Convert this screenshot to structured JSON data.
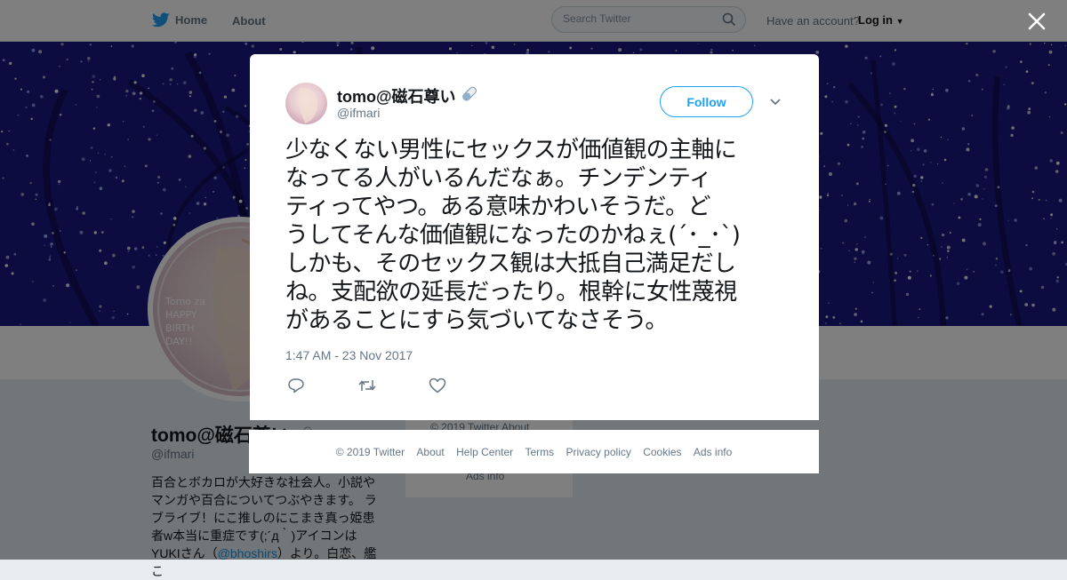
{
  "topnav": {
    "home_label": "Home",
    "about_label": "About",
    "search_placeholder": "Search Twitter",
    "account_prompt": "Have an account?",
    "login_label": "Log in"
  },
  "profile": {
    "name": "tomo@磁石尊い",
    "handle": "@ifmari",
    "avatar_text": "Tomo za HAPPY BIRTH DAY!!",
    "bio_before_link": "百合とボカロが大好きな社会人。小説やマンガや百合についてつぶやきます。 ラブライブ！にこ推しのにこまき真っ姫患者w本当に重症です(;´д｀)アイコンはYUKIさん（",
    "bio_link": "@bhoshirs",
    "bio_after_link": "）より。白恋、艦こ"
  },
  "side_card": {
    "line1": "© 2019 Twitter   About",
    "line2": "Ads info"
  },
  "tweet": {
    "author_name": "tomo@磁石尊い",
    "author_handle": "@ifmari",
    "follow_label": "Follow",
    "lines": [
      "少なくない男性にセックスが価値観の主軸に",
      "なってる人がいるんだなぁ。チンデンティ",
      "ティってやつ。ある意味かわいそうだ。ど",
      "うしてそんな価値観になったのかねぇ(´･_･`)",
      "しかも、そのセックス観は大抵自己満足だし",
      "ね。支配欲の延長だったり。根幹に女性蔑視",
      "があることにすら気づいてなさそう。"
    ],
    "timestamp": "1:47 AM - 23 Nov 2017"
  },
  "footer": {
    "links": [
      "© 2019 Twitter",
      "About",
      "Help Center",
      "Terms",
      "Privacy policy",
      "Cookies",
      "Ads info"
    ]
  },
  "icons": {
    "bird": "twitter-bird-icon",
    "search": "search-icon",
    "close": "close-icon",
    "reply": "reply-icon",
    "retweet": "retweet-icon",
    "like": "heart-icon",
    "more": "chevron-down-icon",
    "emoji": "pill-icon"
  },
  "colors": {
    "brand_blue": "#1da1f2",
    "text": "#14171a",
    "secondary_text": "#657786",
    "banner": "#1d1a8a",
    "page_bg": "#e6ecf0"
  }
}
